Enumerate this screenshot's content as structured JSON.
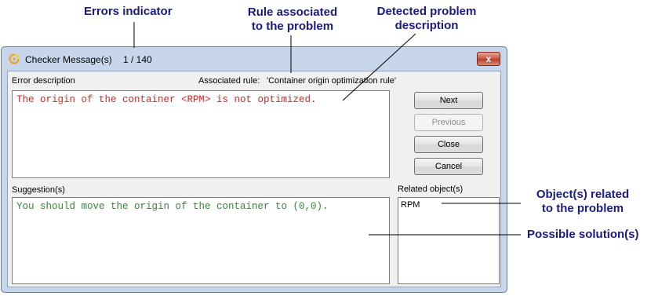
{
  "callouts": {
    "errors_indicator": "Errors indicator",
    "rule_line1": "Rule associated",
    "rule_line2": "to the problem",
    "detected_line1": "Detected problem",
    "detected_line2": "description",
    "objects_line1": "Object(s) related",
    "objects_line2": "to the problem",
    "possible_solutions": "Possible solution(s)"
  },
  "window": {
    "title": "Checker Message(s)",
    "counter": "1 / 140",
    "close_glyph": "x"
  },
  "error": {
    "label": "Error description",
    "rule_label": "Associated rule:",
    "rule_value": "'Container origin optimization rule'",
    "text": "The origin of the container <RPM> is not optimized.",
    "text_color": "#e02020"
  },
  "buttons": {
    "next": "Next",
    "previous": "Previous",
    "close": "Close",
    "cancel": "Cancel"
  },
  "suggestion": {
    "label": "Suggestion(s)",
    "text": "You should move the origin of the container to (0,0).",
    "text_color": "#2e8b2e"
  },
  "related": {
    "label": "Related object(s)",
    "items": [
      "RPM"
    ]
  },
  "colors": {
    "callout": "#1a1a80",
    "window_frame": "#c7d6ea"
  }
}
